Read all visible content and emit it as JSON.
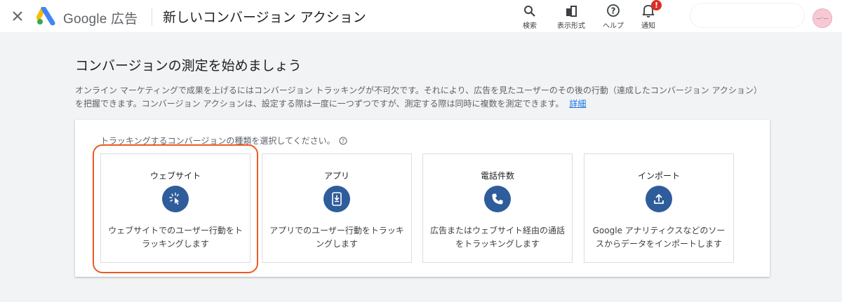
{
  "header": {
    "brand": "Google 広告",
    "page_title": "新しいコンバージョン アクション",
    "tools": [
      {
        "label": "検索",
        "icon": "search-icon"
      },
      {
        "label": "表示形式",
        "icon": "appearance-icon"
      },
      {
        "label": "ヘルプ",
        "icon": "help-icon"
      },
      {
        "label": "通知",
        "icon": "bell-icon",
        "badge": "!"
      }
    ],
    "avatar_text": "—ᵕ—"
  },
  "main": {
    "section_title": "コンバージョンの測定を始めましょう",
    "description": "オンライン マーケティングで成果を上げるにはコンバージョン トラッキングが不可欠です。それにより、広告を見たユーザーのその後の行動（達成したコンバージョン アクション）を把握できます。コンバージョン アクションは、設定する際は一度に一つずつですが、測定する際は同時に複数を測定できます。",
    "learn_more": "詳細",
    "panel_label": "トラッキングするコンバージョンの種類を選択してください。",
    "cards": [
      {
        "title": "ウェブサイト",
        "icon": "cursor-click-icon",
        "description": "ウェブサイトでのユーザー行動をトラッキングします"
      },
      {
        "title": "アプリ",
        "icon": "mobile-app-icon",
        "description": "アプリでのユーザー行動をトラッキングします"
      },
      {
        "title": "電話件数",
        "icon": "phone-icon",
        "description": "広告またはウェブサイト経由の通話をトラッキングします"
      },
      {
        "title": "インポート",
        "icon": "upload-icon",
        "description": "Google アナリティクスなどのソースからデータをインポートします"
      }
    ]
  },
  "colors": {
    "accent_icon_bg": "#2f5d9b",
    "highlight": "#ec5a24",
    "link": "#1a73e8",
    "notification_badge": "#d93025"
  }
}
